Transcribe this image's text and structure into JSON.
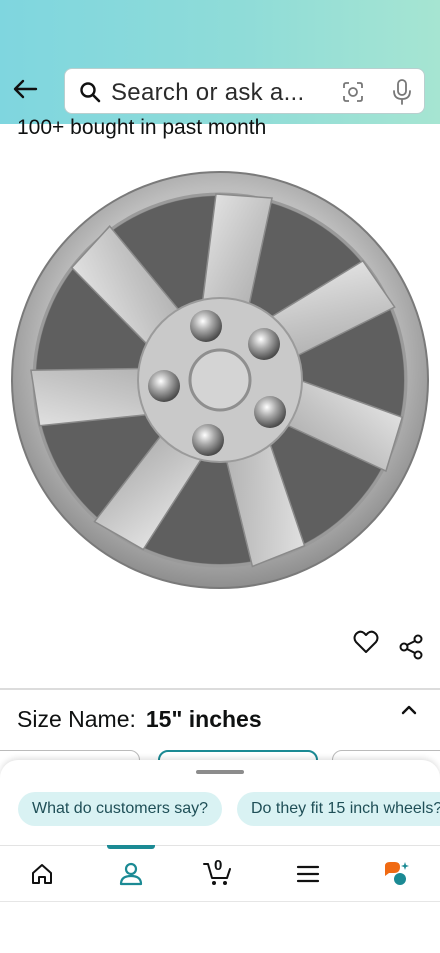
{
  "header": {
    "search_placeholder": "Search or ask a...",
    "back_icon": "arrow-left-icon",
    "lens_icon": "camera-lens-icon",
    "mic_icon": "microphone-icon"
  },
  "product": {
    "bought_text": "100+ bought in past month",
    "image_alt": "Silver wheel cover hubcap"
  },
  "actions": {
    "favorite_icon": "heart-icon",
    "share_icon": "share-icon"
  },
  "size": {
    "label": "Size Name:",
    "value": "15\" inches"
  },
  "suggestions": [
    {
      "label": "What do customers say?"
    },
    {
      "label": "Do they fit 15 inch wheels?"
    }
  ],
  "nav": {
    "cart_count": "0",
    "items": [
      "home",
      "account",
      "cart",
      "menu",
      "rufus"
    ],
    "accent_color": "#1b8a94"
  }
}
